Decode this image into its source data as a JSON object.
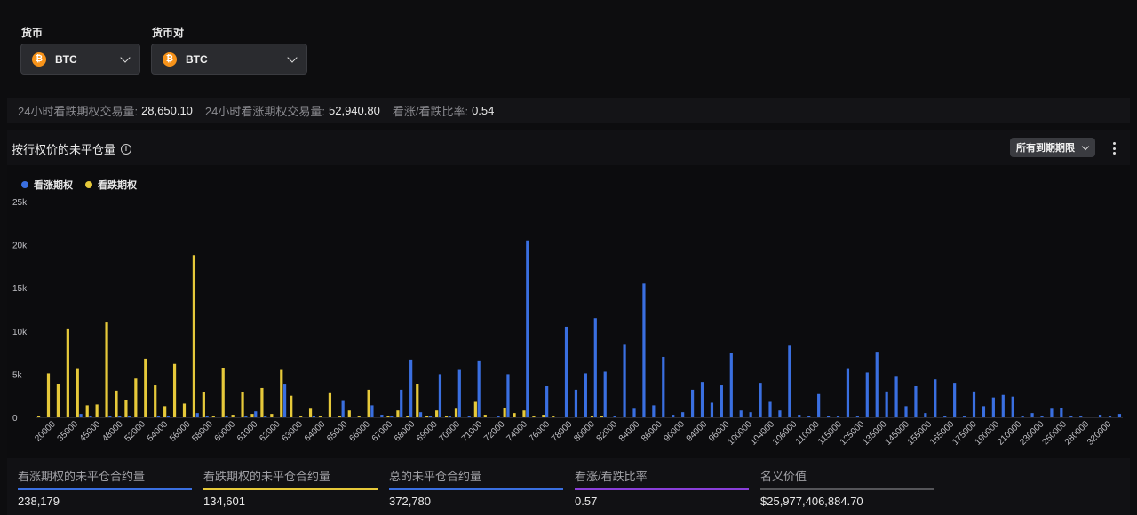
{
  "selectors": {
    "currency_label": "货币",
    "currency_value": "BTC",
    "pair_label": "货币对",
    "pair_value": "BTC",
    "coin_glyph": "₿"
  },
  "summary": {
    "put_volume_label": "24小时看跌期权交易量:",
    "put_volume_value": "28,650.10",
    "call_volume_label": "24小时看涨期权交易量:",
    "call_volume_value": "52,940.80",
    "ratio_label": "看涨/看跌比率:",
    "ratio_value": "0.54"
  },
  "panel": {
    "title": "按行权价的未平仓量",
    "expiry_filter": "所有到期期限"
  },
  "colors": {
    "call": "#3a6fe0",
    "put": "#e6c93a",
    "grid": "#26262b",
    "axis_text": "#bfbfc4",
    "total": "#3a6fe0",
    "ratio": "#8a3fd9",
    "notional": "#555559"
  },
  "chart_data": {
    "type": "bar",
    "title": "按行权价的未平仓量",
    "xlabel": "",
    "ylabel": "",
    "ylim": [
      0,
      25000
    ],
    "yticks": [
      0,
      5000,
      10000,
      15000,
      20000,
      25000
    ],
    "ytick_labels": [
      "0",
      "5k",
      "10k",
      "15k",
      "20k",
      "25k"
    ],
    "legend_position": "top-left",
    "grid": false,
    "tick_labels": [
      "20000",
      "35000",
      "45000",
      "48000",
      "52000",
      "54000",
      "56000",
      "58000",
      "60000",
      "61000",
      "62000",
      "63000",
      "64000",
      "65000",
      "66000",
      "67000",
      "68000",
      "69000",
      "70000",
      "71000",
      "72000",
      "74000",
      "76000",
      "78000",
      "80000",
      "82000",
      "84000",
      "86000",
      "90000",
      "94000",
      "96000",
      "100000",
      "104000",
      "106000",
      "110000",
      "115000",
      "125000",
      "135000",
      "145000",
      "155000",
      "165000",
      "175000",
      "190000",
      "210000",
      "230000",
      "250000",
      "280000",
      "320000"
    ],
    "series": [
      {
        "name": "看涨期权",
        "values": [
          0,
          0,
          0,
          0,
          400,
          100,
          0,
          100,
          200,
          100,
          0,
          0,
          100,
          100,
          0,
          0,
          500,
          100,
          0,
          200,
          0,
          100,
          700,
          100,
          0,
          3800,
          0,
          0,
          100,
          0,
          0,
          1900,
          0,
          0,
          1400,
          300,
          200,
          3200,
          6700,
          600,
          200,
          5000,
          100,
          5500,
          100,
          6600,
          0,
          100,
          5000,
          0,
          20500,
          0,
          3600,
          0,
          10500,
          3200,
          5100,
          11500,
          5300,
          200,
          8500,
          1000,
          15500,
          1400,
          7000,
          300,
          600,
          3200,
          4100,
          1700,
          3700,
          7500,
          800,
          600,
          4000,
          1800,
          800,
          8300,
          300,
          200,
          2700,
          200,
          100,
          5600,
          100,
          5200,
          7600,
          3000,
          4700,
          1300,
          3600,
          500,
          4400,
          200,
          4000,
          100,
          3000,
          1300,
          2300,
          2600,
          2400,
          100,
          500,
          100,
          1000,
          1100,
          200,
          100,
          0,
          300,
          100,
          400
        ]
      },
      {
        "name": "看跌期权",
        "values": [
          100,
          5100,
          3900,
          10300,
          5600,
          1400,
          1500,
          11000,
          3100,
          2000,
          4500,
          6800,
          3700,
          1300,
          6200,
          1600,
          18800,
          2900,
          100,
          5700,
          300,
          2900,
          400,
          3400,
          400,
          5500,
          2500,
          100,
          1000,
          100,
          2800,
          100,
          800,
          100,
          3200,
          0,
          100,
          800,
          200,
          3900,
          200,
          800,
          100,
          1000,
          0,
          1800,
          300,
          0,
          1100,
          500,
          800,
          100,
          300,
          100,
          0,
          0,
          0,
          100,
          100,
          0,
          0,
          0,
          0,
          0,
          0,
          0,
          0,
          0,
          0,
          0,
          0,
          0,
          0,
          0,
          0,
          0,
          0,
          0,
          0,
          0,
          0,
          0,
          0,
          0,
          0,
          0,
          0,
          0,
          0,
          0,
          0,
          0,
          0,
          0,
          0,
          0,
          0,
          0,
          0,
          0,
          0,
          0,
          0,
          0,
          0,
          0,
          0,
          0,
          0,
          0,
          0,
          0,
          0,
          0,
          0,
          0,
          0,
          0,
          0
        ]
      }
    ]
  },
  "stats": [
    {
      "label": "看涨期权的未平仓合约量",
      "value": "238,179",
      "color": "#3a6fe0"
    },
    {
      "label": "看跌期权的未平仓合约量",
      "value": "134,601",
      "color": "#e6c93a"
    },
    {
      "label": "总的未平仓合约量",
      "value": "372,780",
      "color": "#3a6fe0"
    },
    {
      "label": "看涨/看跌比率",
      "value": "0.57",
      "color": "#8a3fd9"
    },
    {
      "label": "名义价值",
      "value": "$25,977,406,884.70",
      "color": "#555559"
    }
  ]
}
